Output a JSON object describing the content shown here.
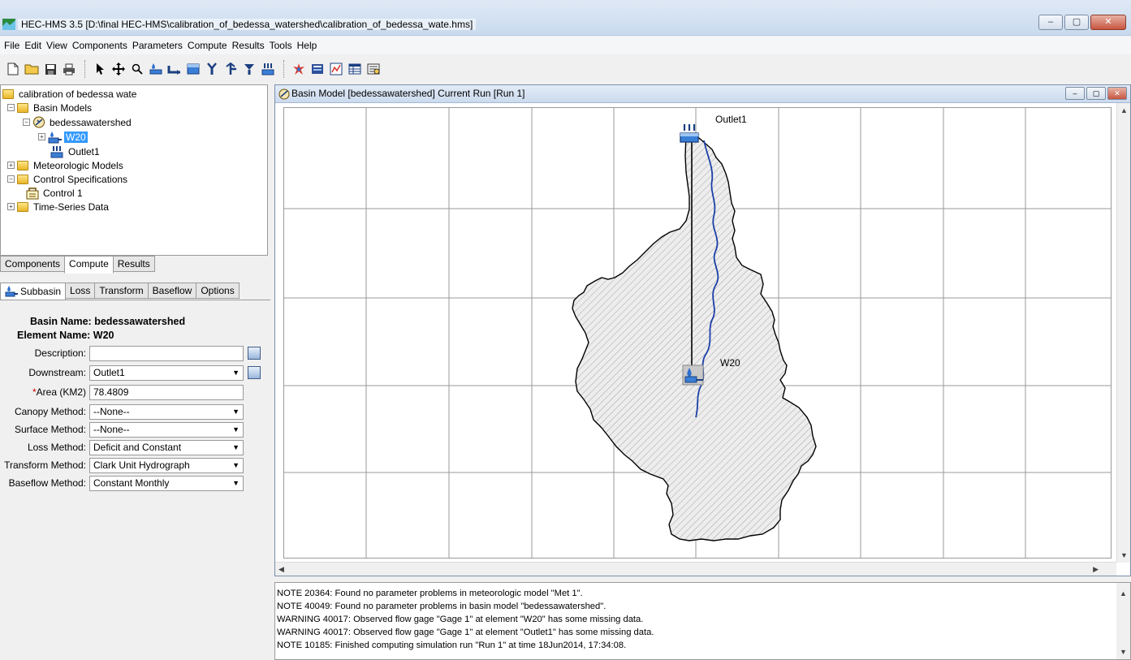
{
  "window": {
    "title": "HEC-HMS 3.5 [D:\\final HEC-HMS\\calibration_of_bedessa_watershed\\calibration_of_bedessa_wate.hms]",
    "controls": {
      "minimize": "–",
      "maximize": "▢",
      "close": "✕"
    }
  },
  "menu": [
    "File",
    "Edit",
    "View",
    "Components",
    "Parameters",
    "Compute",
    "Results",
    "Tools",
    "Help"
  ],
  "toolbar": {
    "icons": [
      "new-file-icon",
      "open-folder-icon",
      "save-icon",
      "print-icon",
      "arrow-select-icon",
      "pan-icon",
      "zoom-icon",
      "subbasin-tool-icon",
      "reach-tool-icon",
      "reservoir-tool-icon",
      "junction-tool-icon",
      "diversion-tool-icon",
      "source-tool-icon",
      "sink-tool-icon",
      "compute-icon",
      "global-summary-icon",
      "graph-icon",
      "table-icon",
      "time-series-icon"
    ]
  },
  "tree": {
    "project": "calibration of bedessa wate",
    "basin_models": "Basin Models",
    "basin": "bedessawatershed",
    "subbasin": "W20",
    "outlet": "Outlet1",
    "meteorologic": "Meteorologic Models",
    "control_specs": "Control Specifications",
    "control": "Control 1",
    "time_series": "Time-Series Data"
  },
  "component_tabs": [
    "Components",
    "Compute",
    "Results"
  ],
  "editor_tabs": [
    "Subbasin",
    "Loss",
    "Transform",
    "Baseflow",
    "Options"
  ],
  "editor": {
    "basin_name_label": "Basin Name:",
    "basin_name": "bedessawatershed",
    "element_name_label": "Element Name:",
    "element_name": "W20",
    "description_label": "Description:",
    "description": "",
    "downstream_label": "Downstream:",
    "downstream": "Outlet1",
    "area_required": "*",
    "area_label": "Area (KM2)",
    "area": "78.4809",
    "canopy_label": "Canopy Method:",
    "canopy": "--None--",
    "surface_label": "Surface Method:",
    "surface": "--None--",
    "loss_label": "Loss Method:",
    "loss": "Deficit and Constant",
    "transform_label": "Transform Method:",
    "transform": "Clark Unit Hydrograph",
    "baseflow_label": "Baseflow Method:",
    "baseflow": "Constant Monthly"
  },
  "basin_window": {
    "title": "Basin Model [bedessawatershed]  Current Run [Run 1]",
    "elements": {
      "outlet": "Outlet1",
      "subbasin": "W20"
    }
  },
  "log": [
    "NOTE 20364:  Found no parameter problems in meteorologic model \"Met 1\".",
    "NOTE 40049:  Found no parameter problems in basin model \"bedessawatershed\".",
    "WARNING 40017:  Observed flow gage \"Gage 1\" at element \"W20\" has some missing data.",
    "WARNING 40017:  Observed flow gage \"Gage 1\" at element \"Outlet1\" has some missing data.",
    "NOTE 10185:  Finished computing simulation run \"Run 1\" at time 18Jun2014, 17:34:08."
  ]
}
